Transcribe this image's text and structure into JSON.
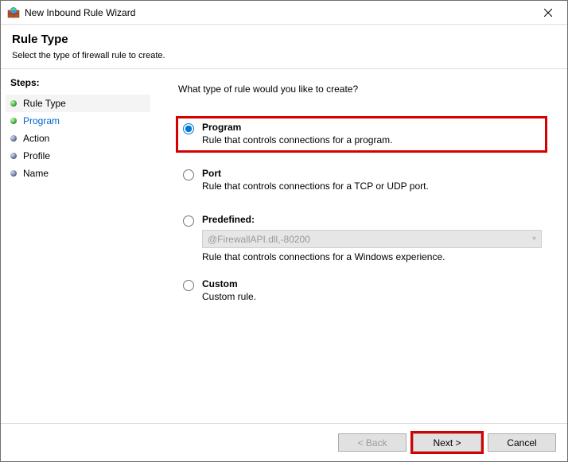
{
  "titlebar": {
    "title": "New Inbound Rule Wizard"
  },
  "header": {
    "heading": "Rule Type",
    "description": "Select the type of firewall rule to create."
  },
  "steps": {
    "title": "Steps:",
    "items": [
      {
        "label": "Rule Type",
        "state": "current"
      },
      {
        "label": "Program",
        "state": "link"
      },
      {
        "label": "Action",
        "state": "future"
      },
      {
        "label": "Profile",
        "state": "future"
      },
      {
        "label": "Name",
        "state": "future"
      }
    ]
  },
  "main": {
    "prompt": "What type of rule would you like to create?",
    "options": {
      "program": {
        "title": "Program",
        "desc": "Rule that controls connections for a program."
      },
      "port": {
        "title": "Port",
        "desc": "Rule that controls connections for a TCP or UDP port."
      },
      "predefined": {
        "title": "Predefined:",
        "select_value": "@FirewallAPI.dll,-80200",
        "desc": "Rule that controls connections for a Windows experience."
      },
      "custom": {
        "title": "Custom",
        "desc": "Custom rule."
      }
    }
  },
  "footer": {
    "back": "< Back",
    "next": "Next >",
    "cancel": "Cancel"
  }
}
